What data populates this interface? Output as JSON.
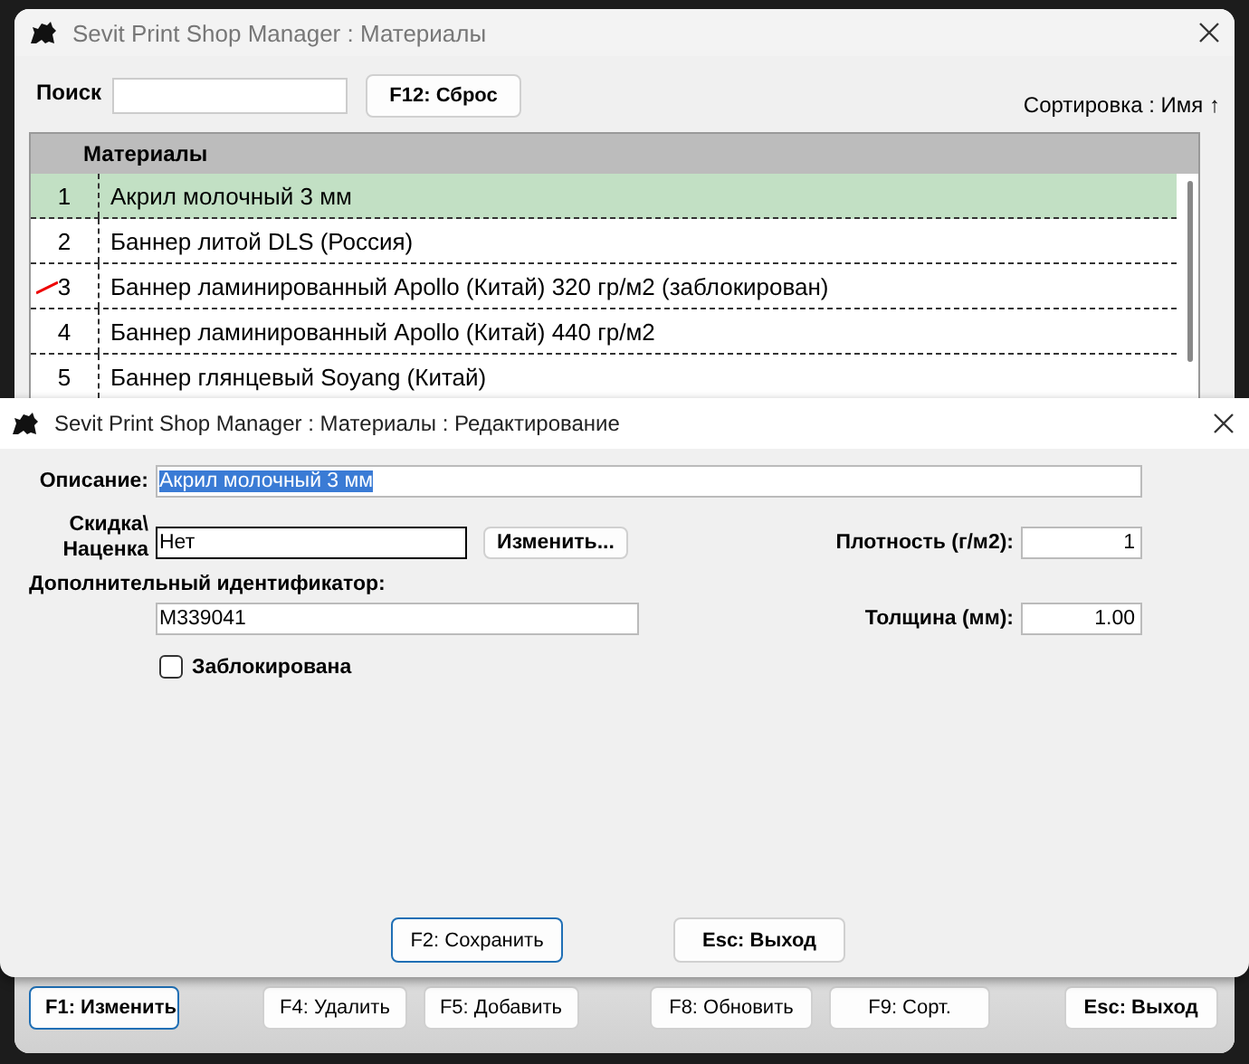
{
  "main_window": {
    "title": "Sevit Print Shop Manager : Материалы"
  },
  "search": {
    "label": "Поиск"
  },
  "reset_button": "F12: Сброс",
  "sort_label": "Сортировка : Имя ↑",
  "table": {
    "columns": [
      "Материалы"
    ],
    "rows": [
      {
        "number": "1",
        "name": "Акрил молочный 3 мм",
        "selected": true,
        "blocked": false
      },
      {
        "number": "2",
        "name": "Баннер литой DLS (Россия)",
        "selected": false,
        "blocked": false
      },
      {
        "number": "3",
        "name": "Баннер ламинированный Apollo (Китай) 320 гр/м2 (заблокирован)",
        "selected": false,
        "blocked": true
      },
      {
        "number": "4",
        "name": "Баннер ламинированный Apollo (Китай) 440 гр/м2",
        "selected": false,
        "blocked": false
      },
      {
        "number": "5",
        "name": "Баннер глянцевый Soyang (Китай)",
        "selected": false,
        "blocked": false
      }
    ]
  },
  "bottom_buttons": [
    {
      "label": "F1: Изменить",
      "bold": true,
      "focused": true
    },
    {
      "label": "F4: Удалить",
      "bold": false,
      "focused": false
    },
    {
      "label": "F5: Добавить",
      "bold": false,
      "focused": false
    },
    {
      "label": "F8: Обновить",
      "bold": false,
      "focused": false
    },
    {
      "label": "F9: Сорт.",
      "bold": false,
      "focused": false
    },
    {
      "label": "Esc: Выход",
      "bold": true,
      "focused": false
    }
  ],
  "dialog": {
    "title": "Sevit Print Shop Manager : Материалы : Редактирование",
    "description": {
      "label": "Описание:",
      "value": "Акрил молочный 3 мм",
      "text_selected": true
    },
    "discount": {
      "label": "Скидка\\ Наценка",
      "value": "Нет",
      "button": "Изменить..."
    },
    "density": {
      "label": "Плотность (г/м2):",
      "value": "1"
    },
    "extra_id": {
      "label": "Дополнительный идентификатор:",
      "value": "M339041"
    },
    "thickness": {
      "label": "Толщина (мм):",
      "value": "1.00"
    },
    "blocked": {
      "label": "Заблокирована",
      "checked": false
    },
    "buttons": [
      {
        "label": "F2: Сохранить",
        "bold": false,
        "focused": true
      },
      {
        "label": "Esc: Выход",
        "bold": true,
        "focused": false
      }
    ]
  }
}
